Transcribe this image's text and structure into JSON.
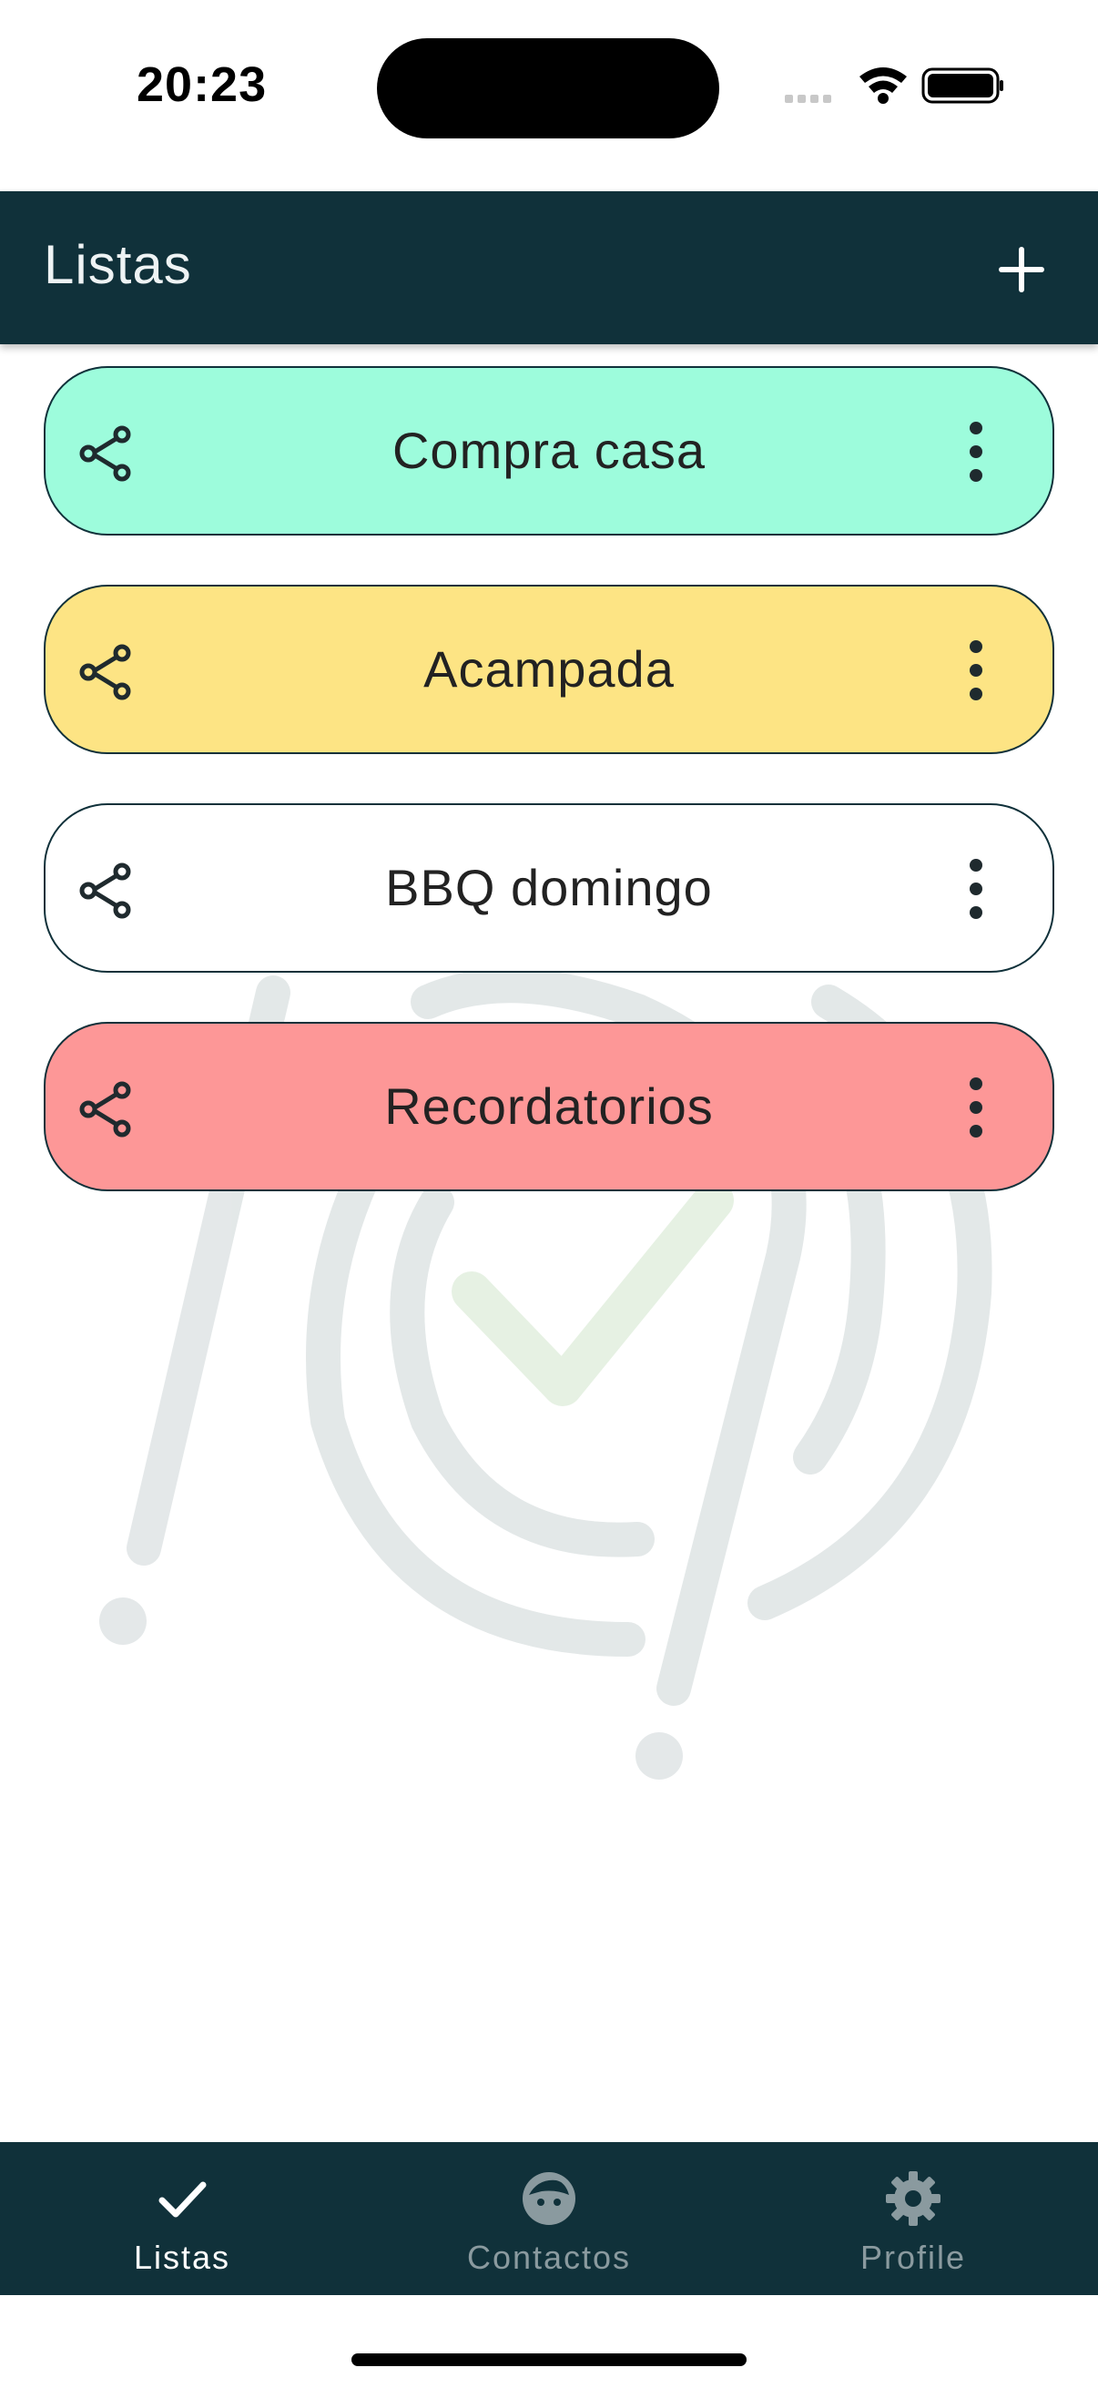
{
  "status_bar": {
    "time": "20:23"
  },
  "app_bar": {
    "title": "Listas",
    "add_icon": "plus-icon"
  },
  "lists": [
    {
      "name": "Compra casa",
      "color": "#9dfcdc"
    },
    {
      "name": "Acampada",
      "color": "#fde484"
    },
    {
      "name": "BBQ domingo",
      "color": "#ffffff"
    },
    {
      "name": "Recordatorios",
      "color": "#fd9797"
    }
  ],
  "bottom_nav": {
    "items": [
      {
        "label": "Listas",
        "icon": "check-icon",
        "active": true
      },
      {
        "label": "Contactos",
        "icon": "face-icon",
        "active": false
      },
      {
        "label": "Profile",
        "icon": "gear-icon",
        "active": false
      }
    ]
  },
  "colors": {
    "primary": "#10313a",
    "nav_inactive": "#8a9a9f"
  }
}
